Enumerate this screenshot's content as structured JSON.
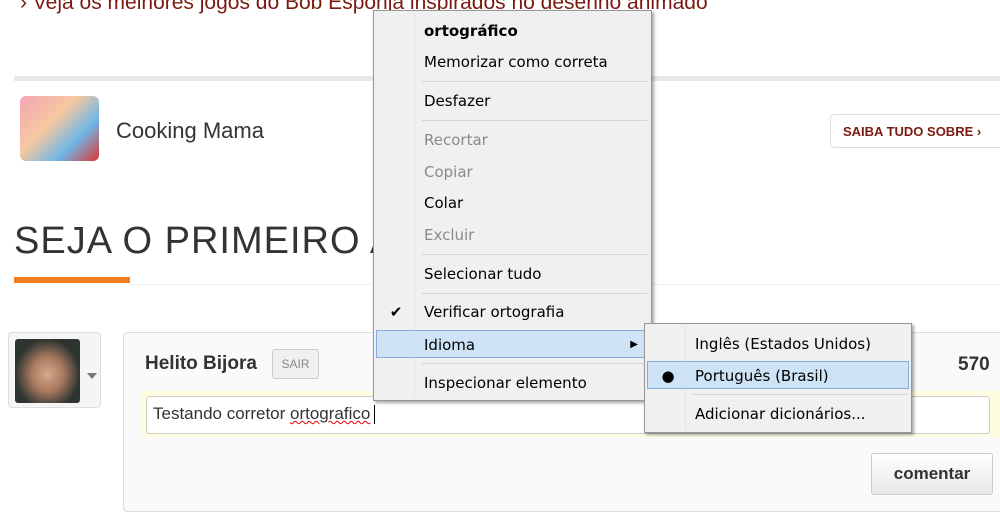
{
  "page": {
    "top_link": "› Veja os melhores jogos do Bob Esponja inspirados no desenho animado",
    "game_name": "Cooking Mama",
    "saiba_label": "SAIBA TUDO SOBRE ›",
    "section_title": "SEJA O PRIMEIRO A"
  },
  "comment": {
    "user": "Helito Bijora",
    "sair": "SAIR",
    "count": "570",
    "text_before": "Testando corretor ",
    "misspelled": "ortografico",
    "submit": "comentar"
  },
  "context_menu": {
    "items": [
      {
        "label": "ortográfico"
      },
      {
        "label": "Memorizar como correta"
      },
      {
        "label": "Desfazer"
      },
      {
        "label": "Recortar"
      },
      {
        "label": "Copiar"
      },
      {
        "label": "Colar"
      },
      {
        "label": "Excluir"
      },
      {
        "label": "Selecionar tudo"
      },
      {
        "label": "Verificar ortografia"
      },
      {
        "label": "Idioma"
      },
      {
        "label": "Inspecionar elemento"
      }
    ]
  },
  "submenu": {
    "items": [
      {
        "label": "Inglês (Estados Unidos)"
      },
      {
        "label": "Português (Brasil)"
      },
      {
        "label": "Adicionar dicionários..."
      }
    ]
  },
  "colors": {
    "accent": "#f47b20",
    "link": "#7a1a10",
    "highlight": "#cfe3f7"
  }
}
